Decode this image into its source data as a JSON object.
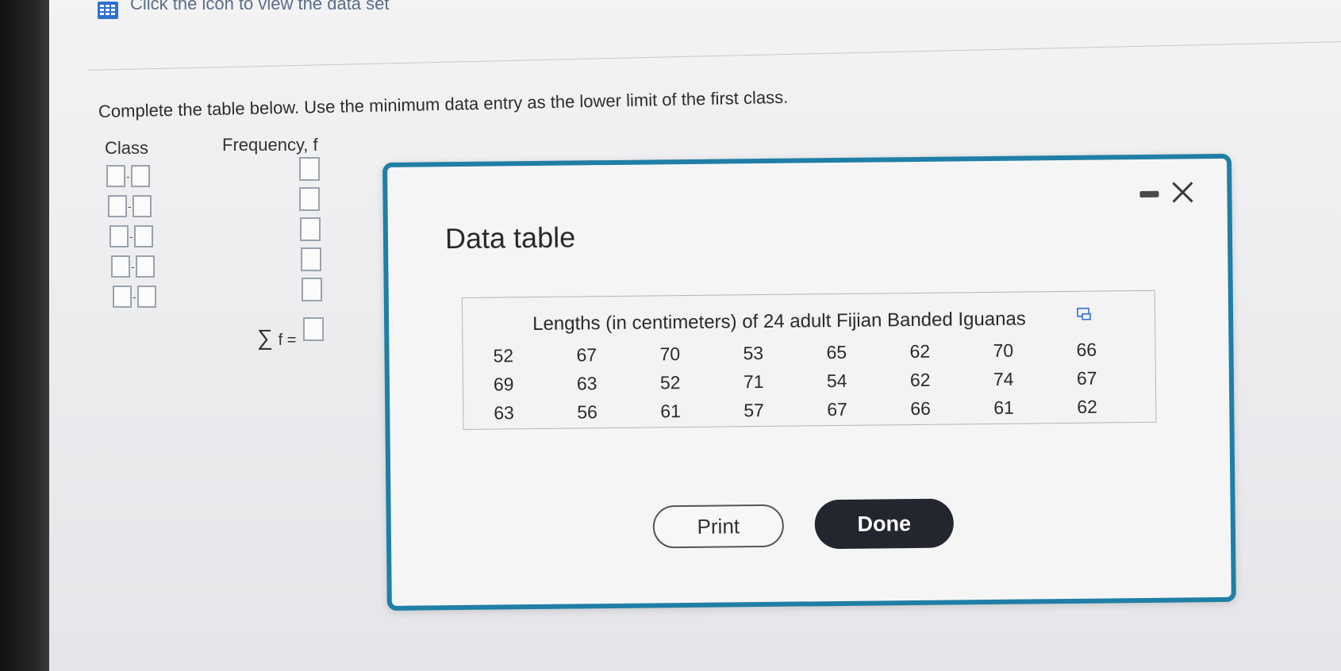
{
  "topbar": {
    "icon": "grid-icon",
    "link_text": "Click the icon to view the data set"
  },
  "question": {
    "instruction": "Complete the table below. Use the minimum data entry as the lower limit of the first class.",
    "class_header": "Class",
    "frequency_header": "Frequency, f",
    "dash": "-",
    "sum_sigma": "∑",
    "sum_label": "f ="
  },
  "modal": {
    "title": "Data table",
    "minimize_icon": "minimize-icon",
    "close_icon": "close-icon",
    "caption": "Lengths (in centimeters) of 24 adult Fijian Banded Iguanas",
    "expand_icon": "expand-icon",
    "rows": [
      [
        "52",
        "67",
        "70",
        "53",
        "65",
        "62",
        "70",
        "66"
      ],
      [
        "69",
        "63",
        "52",
        "71",
        "54",
        "62",
        "74",
        "67"
      ],
      [
        "63",
        "56",
        "61",
        "57",
        "67",
        "66",
        "61",
        "62"
      ]
    ],
    "print_label": "Print",
    "done_label": "Done"
  },
  "colors": {
    "modal_border": "#1f7fa6",
    "done_bg": "#23262f",
    "link_text": "#5a6e8a"
  }
}
